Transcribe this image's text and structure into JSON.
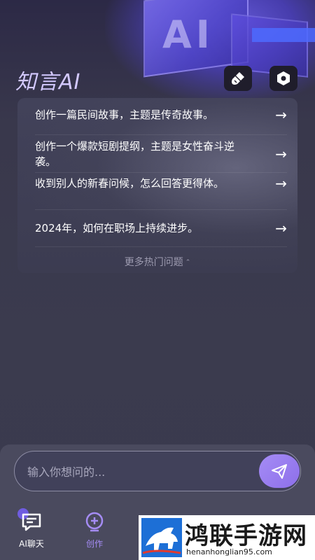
{
  "app": {
    "title": "知言AI",
    "hero_text": "AI"
  },
  "header": {
    "brush_icon": "brush-icon",
    "settings_icon": "settings-icon"
  },
  "questions": [
    {
      "text": "创作一篇民间故事，主题是传奇故事。",
      "arrow": "→"
    },
    {
      "text": "创作一个爆款短剧提纲，主题是女性奋斗逆袭。",
      "arrow": "→"
    },
    {
      "text": "收到别人的新春问候，怎么回答更得体。",
      "arrow": "→"
    },
    {
      "text": "2024年，如何在职场上持续进步。",
      "arrow": "→"
    }
  ],
  "more": {
    "label": "更多热门问题",
    "chevron": "⌃"
  },
  "input": {
    "placeholder": "输入你想问的...",
    "value": ""
  },
  "tabs": [
    {
      "label": "AI聊天",
      "icon": "chat-icon",
      "active": true
    },
    {
      "label": "创作",
      "icon": "create-icon",
      "active": false
    }
  ],
  "watermark": {
    "title": "鸿联手游网",
    "url": "henanhonglian95.com"
  },
  "colors": {
    "accent": "#a58cf5",
    "title": "#d3c9ff",
    "background": "#3a3a4d"
  }
}
